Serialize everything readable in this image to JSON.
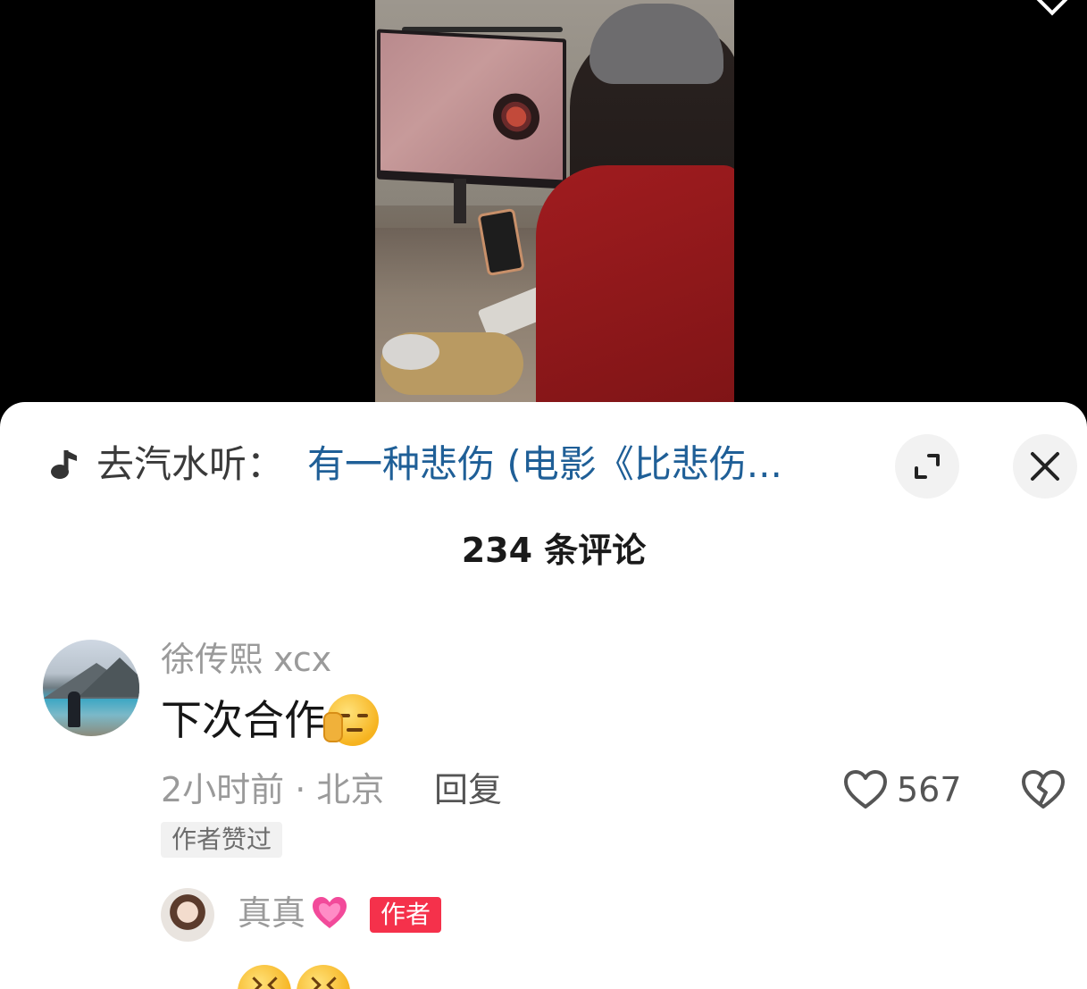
{
  "music": {
    "prefix": "去汽水听：",
    "title": "有一种悲伤 (电影《比悲伤..."
  },
  "comments_count_label": "234 条评论",
  "comment": {
    "username": "徐传熙 xcx",
    "text": "下次合作",
    "time_location": "2小时前 · 北京",
    "reply_label": "回复",
    "likes": "567",
    "liked_by_author_tag": "作者赞过"
  },
  "reply": {
    "username": "真真",
    "author_tag": "作者"
  },
  "colors": {
    "link_blue": "#1f5f97",
    "author_red": "#f5314b"
  },
  "icons": [
    "music-note-icon",
    "expand-icon",
    "close-icon",
    "heart-icon",
    "broken-heart-icon"
  ]
}
